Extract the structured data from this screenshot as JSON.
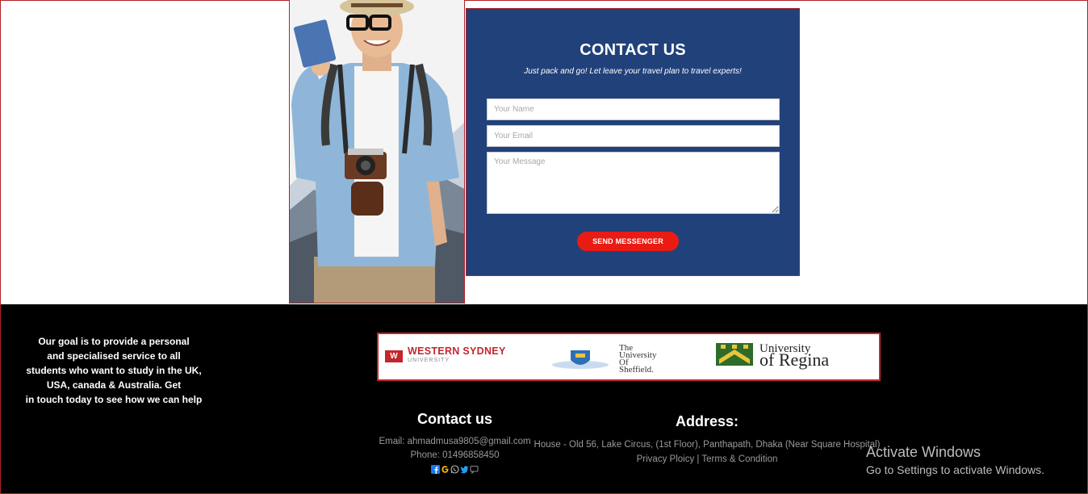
{
  "contact_form": {
    "title": "CONTACT US",
    "subtitle": "Just pack and go! Let leave your travel plan to travel experts!",
    "name_placeholder": "Your Name",
    "email_placeholder": "Your Email",
    "message_placeholder": "Your Message",
    "send_label": "SEND MESSENGER"
  },
  "footer": {
    "goal_lines": [
      "Our goal is to provide a personal",
      "and specialised service to all",
      "students who want to study in the UK,",
      "USA, canada & Australia. Get",
      "in touch today to see how we can help"
    ],
    "logos": {
      "western_sydney": {
        "mark": "W",
        "line1": "WESTERN SYDNEY",
        "line2": "UNIVERSITY"
      },
      "sheffield": {
        "line1": "The",
        "line2": "University",
        "line3": "Of",
        "line4": "Sheffield."
      },
      "regina": {
        "line1": "University",
        "line2": "of Regina"
      }
    },
    "contact": {
      "heading": "Contact us",
      "email": "Email: ahmadmusa9805@gmail.com",
      "phone": "Phone: 01496858450",
      "social_icons": [
        "facebook-icon",
        "google-icon",
        "whatsapp-icon",
        "twitter-icon",
        "chat-icon"
      ]
    },
    "address": {
      "heading": "Address:",
      "text": "House - Old 56, Lake Circus, (1st Floor), Panthapath, Dhaka (Near Square Hospital)",
      "privacy": "Privacy Ploicy",
      "separator": "|",
      "terms": "Terms & Condition"
    }
  },
  "os_overlay": {
    "line1": "Activate Windows",
    "line2": "Go to Settings to activate Windows."
  },
  "colors": {
    "panel": "#21417a",
    "accent_red": "#ea1b12",
    "border_red": "#b0222a",
    "footer_bg": "#000000"
  }
}
